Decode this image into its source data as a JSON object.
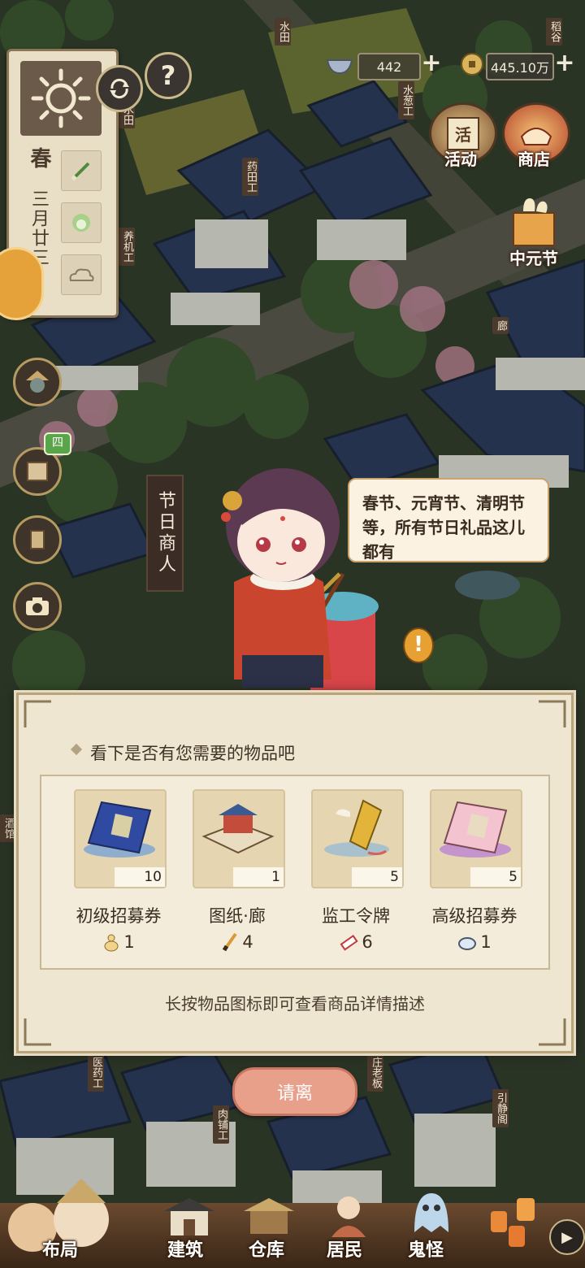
{
  "top_bar": {
    "resource1": {
      "icon": "bowl-icon",
      "value": "442"
    },
    "resource2": {
      "icon": "coin-icon",
      "value": "445.10万"
    },
    "activity_label": "活动",
    "activity_icon_text": "活",
    "shop_label": "商店",
    "event_label": "中元节"
  },
  "season_panel": {
    "season": "春",
    "date": "三月廿三",
    "crops": [
      "scallion-icon",
      "cabbage-icon",
      "cloud-icon"
    ]
  },
  "map_labels": [
    "水田",
    "水田",
    "水葱工",
    "稻谷",
    "药田工",
    "养机工",
    "廊",
    "医药工",
    "庄老板",
    "肉铺工",
    "引静阁",
    "酒馆"
  ],
  "merchant": {
    "sign": "节日商人",
    "speech": "春节、元宵节、清明节等，所有节日礼品这儿都有"
  },
  "dialog": {
    "prompt": "看下是否有您需要的物品吧",
    "items": [
      {
        "name": "初级招募券",
        "qty": "10",
        "price": "1",
        "price_icon": "gourd-icon",
        "img": "book-blue-icon"
      },
      {
        "name": "图纸·廊",
        "qty": "1",
        "price": "4",
        "price_icon": "brush-icon",
        "img": "blueprint-icon"
      },
      {
        "name": "监工令牌",
        "qty": "5",
        "price": "6",
        "price_icon": "firecracker-icon",
        "img": "token-icon"
      },
      {
        "name": "高级招募券",
        "qty": "5",
        "price": "1",
        "price_icon": "fan-icon",
        "img": "book-pink-icon"
      }
    ],
    "hint": "长按物品图标即可查看商品详情描述",
    "leave_label": "请离"
  },
  "bottom_nav": {
    "layout": "布局",
    "build": "建筑",
    "storage": "仓库",
    "residents": "居民",
    "ghost": "鬼怪",
    "play": "▶"
  },
  "side_buttons": {
    "book_badge": "四",
    "alert": "!"
  },
  "colors": {
    "panel": "#efe6d1",
    "leave_button": "#e9a08a",
    "sign": "#3b2d26"
  }
}
